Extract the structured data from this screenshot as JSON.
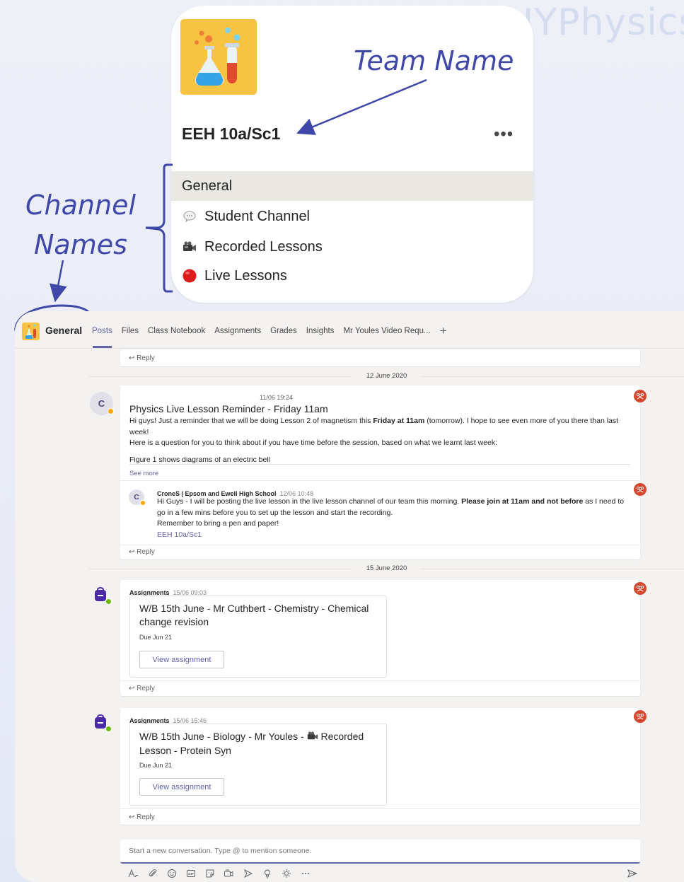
{
  "watermark": "@JYPhysics",
  "team": {
    "name": "EEH 10a/Sc1",
    "more_label": "•••",
    "channels": [
      {
        "label": "General",
        "icon": "none"
      },
      {
        "label": "Student Channel",
        "icon": "speech-bubble-icon"
      },
      {
        "label": "Recorded Lessons",
        "icon": "camcorder-icon"
      },
      {
        "label": "Live Lessons",
        "icon": "red-circle-icon"
      }
    ]
  },
  "annotations": {
    "team_name": "Team Name",
    "channel_names_line1": "Channel",
    "channel_names_line2": "Names"
  },
  "window": {
    "title": "General",
    "tabs": [
      "Posts",
      "Files",
      "Class Notebook",
      "Assignments",
      "Grades",
      "Insights",
      "Mr Youles Video Requ..."
    ],
    "active_tab": "Posts",
    "add_tab": "+"
  },
  "feed": {
    "reply_label": "↩ Reply",
    "dates": [
      "12 June 2020",
      "15 June 2020"
    ],
    "post1": {
      "avatar": "C",
      "time": "11/06 19:24",
      "title": "Physics Live Lesson Reminder - Friday 11am",
      "body_pre": "Hi guys! Just a reminder that we will be doing Lesson 2 of magnetism this ",
      "body_bold": "Friday at 11am",
      "body_post": " (tomorrow). I hope to see even more of you there than last week!",
      "body2": "Here is a question for you to think about if you have time before the session, based on what we learnt last week:",
      "body3": "Figure 1 shows diagrams of an electric bell",
      "see_more": "See more",
      "reply": {
        "avatar": "C",
        "author": "CroneS | Epsom and Ewell High School",
        "time": "12/06 10:48",
        "text_pre": "Hi Guys - I will be posting the live lesson in the live lesson channel of our team this morning. ",
        "text_bold": "Please join at 11am and not before",
        "text_post": " as I need to go in a few mins before you to set up the lesson and start the recording.",
        "text2": "Remember to bring a pen and paper!",
        "link": "EEH 10a/Sc1"
      }
    },
    "assign1": {
      "author": "Assignments",
      "time": "15/06 09:03",
      "title": "W/B 15th June - Mr Cuthbert - Chemistry - Chemical change revision",
      "due": "Due Jun 21",
      "button": "View assignment"
    },
    "assign2": {
      "author": "Assignments",
      "time": "15/06 15:46",
      "title_pre": "W/B 15th June - Biology - Mr Youles - ",
      "title_post": " Recorded Lesson - Protein Syn",
      "due": "Due Jun 21",
      "button": "View assignment"
    }
  },
  "compose": {
    "placeholder": "Start a new conversation. Type @ to mention someone.",
    "tools": [
      "format-icon",
      "attach-icon",
      "emoji-icon",
      "gif-icon",
      "sticker-icon",
      "meet-now-icon",
      "praise-icon",
      "lightbulb-icon",
      "sun-icon",
      "more-options-icon"
    ]
  },
  "colors": {
    "accent": "#6264a7",
    "annotation": "#3f48a8",
    "team_tile": "#f6c343",
    "badge": "#d6482f"
  }
}
